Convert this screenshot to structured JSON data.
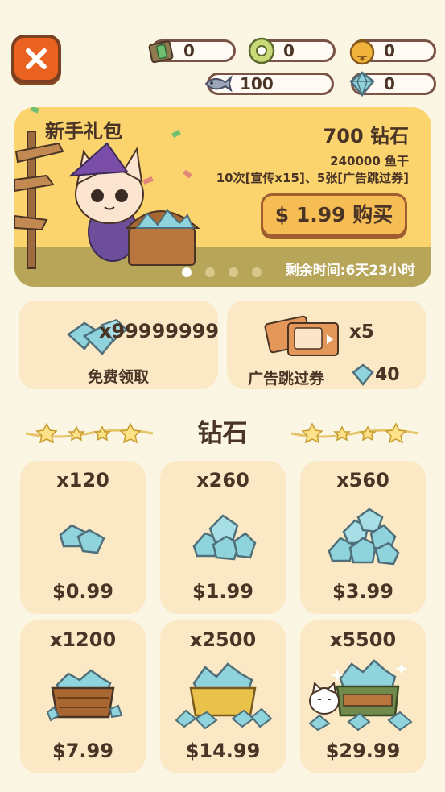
{
  "header": {
    "close_icon": "close-x-icon",
    "resources": [
      {
        "icon": "ticket-icon",
        "value": "0"
      },
      {
        "icon": "coin-icon",
        "value": "0"
      },
      {
        "icon": "bell-icon",
        "value": "0"
      },
      {
        "icon": "fish-icon",
        "value": "100"
      },
      {
        "icon": "diamond-icon",
        "value": "0"
      }
    ]
  },
  "banner": {
    "title": "新手礼包",
    "amount": "700 钻石",
    "fish": "240000 鱼干",
    "detail": "10次[宣传x15]、5张[广告跳过券]",
    "buy_label": "$ 1.99 购买",
    "timer": "剩余时间:6天23小时",
    "page_count": 4,
    "active_page": 0
  },
  "offers": {
    "free": {
      "quantity": "x99999999",
      "label": "免费领取"
    },
    "ad_skip": {
      "quantity": "x5",
      "label": "广告跳过券",
      "cost": "40"
    }
  },
  "section_title": "钻石",
  "packs": [
    {
      "quantity": "x120",
      "price": "$0.99"
    },
    {
      "quantity": "x260",
      "price": "$1.99"
    },
    {
      "quantity": "x560",
      "price": "$3.99"
    },
    {
      "quantity": "x1200",
      "price": "$7.99"
    },
    {
      "quantity": "x2500",
      "price": "$14.99"
    },
    {
      "quantity": "x5500",
      "price": "$29.99"
    }
  ],
  "colors": {
    "background": "#fbf5e4",
    "card": "#fbe8c4",
    "banner": "#fbd46e",
    "close_button": "#e9621f",
    "diamond": "#8fd3dc",
    "text": "#4a3426"
  }
}
